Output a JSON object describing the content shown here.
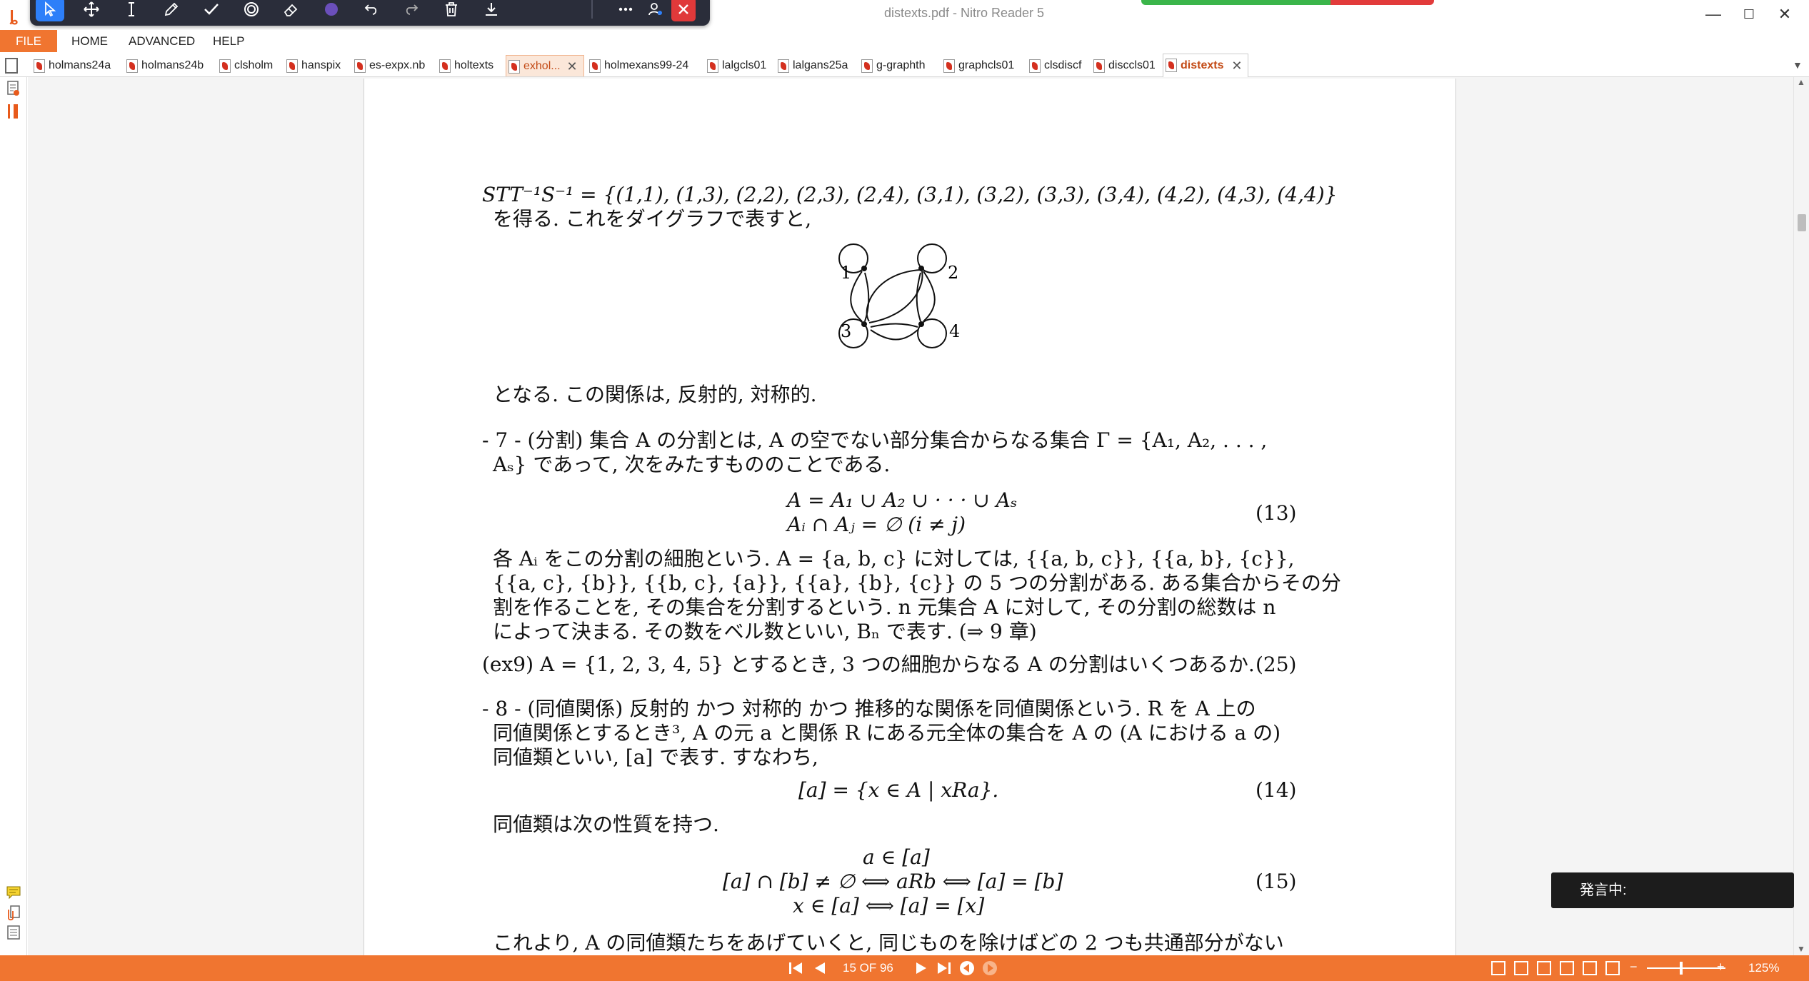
{
  "window": {
    "title": "distexts.pdf - Nitro Reader 5",
    "minimize": "—",
    "maximize": "☐",
    "close": "✕"
  },
  "floating_toolbar": {
    "icons": [
      "select-icon",
      "pan-icon",
      "text-cursor-icon",
      "pen-icon",
      "checkmark-icon",
      "stamp-icon",
      "eraser-icon",
      "color-dot-icon",
      "undo-icon",
      "redo-icon",
      "trash-icon",
      "download-icon",
      "more-icon",
      "user-settings-icon",
      "close-icon"
    ],
    "accent": "#2d7ff9",
    "color_dot": "#6b4fbb"
  },
  "menu": {
    "file": "FILE",
    "home": "HOME",
    "advanced": "ADVANCED",
    "help": "HELP"
  },
  "tabs": [
    {
      "label": "holmans24a"
    },
    {
      "label": "holmans24b"
    },
    {
      "label": "clsholm"
    },
    {
      "label": "hanspix"
    },
    {
      "label": "es-expx.nb"
    },
    {
      "label": "holtexts"
    },
    {
      "label": "exhol..."
    },
    {
      "label": "holmexans99-24"
    },
    {
      "label": "lalgcls01"
    },
    {
      "label": "lalgans25a"
    },
    {
      "label": "g-graphth"
    },
    {
      "label": "graphcls01"
    },
    {
      "label": "clsdiscf"
    },
    {
      "label": "disccls01"
    },
    {
      "label": "distexts"
    }
  ],
  "tab_close": "✕",
  "document": {
    "line1": "STT⁻¹S⁻¹ = {(1,1), (1,3), (2,2), (2,3), (2,4), (3,1), (3,2), (3,3), (3,4), (4,2), (4,3), (4,4)}",
    "line2": "を得る. これをダイグラフで表すと,",
    "graph_nodes": [
      "1",
      "2",
      "3",
      "4"
    ],
    "line3": "となる. この関係は, 反射的, 対称的.",
    "sec7_line1": "- 7 - (分割) 集合 A の分割とは, A の空でない部分集合からなる集合 Γ = {A₁, A₂, . . . ,",
    "sec7_line2": "Aₛ} であって, 次をみたすもののことである.",
    "eq13_line1": "A = A₁ ∪ A₂ ∪ · · · ∪ Aₛ",
    "eq13_line2": "Aᵢ ∩ Aⱼ = ∅        (i ≠ j)",
    "eq13_no": "(13)",
    "para_line1": "各 Aᵢ をこの分割の細胞という.  A = {a, b, c} に対しては, {{a, b, c}}, {{a, b}, {c}},",
    "para_line2": "{{a, c}, {b}}, {{b, c}, {a}}, {{a}, {b}, {c}} の 5 つの分割がある. ある集合からその分",
    "para_line3": "割を作ることを, その集合を分割するという. n 元集合 A に対して, その分割の総数は n",
    "para_line4": "によって決まる. その数をベル数といい, Bₙ で表す. (⇒ 9 章)",
    "ex9": "(ex9)  A = {1, 2, 3, 4, 5} とするとき, 3 つの細胞からなる A の分割はいくつあるか.",
    "ex9_no": "(25)",
    "sec8_line1": "- 8 - (同値関係) 反射的 かつ 対称的 かつ 推移的な関係を同値関係という. R を A 上の",
    "sec8_line2": "同値関係とするとき³, A の元 a と関係 R にある元全体の集合を A の (A における a の)",
    "sec8_line3": "同値類といい, [a] で表す. すなわち,",
    "eq14": "[a] = {x ∈ A | xRa}.",
    "eq14_no": "(14)",
    "line_prop": "同値類は次の性質を持つ.",
    "eq15_line1": "a ∈ [a]",
    "eq15_line2": "[a] ∩ [b] ≠ ∅  ⟺  aRb  ⟺  [a] = [b]",
    "eq15_line3": "x ∈ [a]  ⟺  [a] = [x]",
    "eq15_no": "(15)",
    "last_line": "これより, A の同値類たちをあげていくと, 同じものを除けばどの 2 つも共通部分がない"
  },
  "speaking_popup": "発言中:",
  "statusbar": {
    "page_counter": "15 OF 96",
    "zoom": "125%",
    "zoom_minus": "−",
    "zoom_plus": "+",
    "accent": "#f07530"
  }
}
